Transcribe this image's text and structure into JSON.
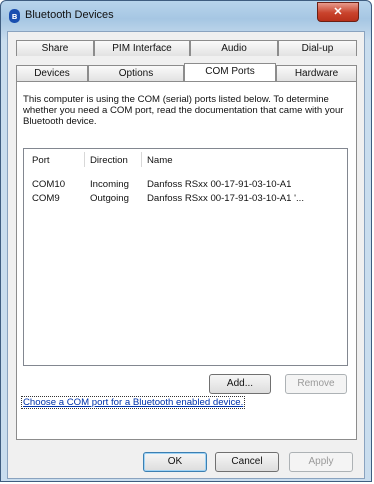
{
  "window": {
    "title": "Bluetooth Devices",
    "close_glyph": "✕"
  },
  "tabs_row_back": [
    {
      "label": "Share"
    },
    {
      "label": "PIM Interface"
    },
    {
      "label": "Audio"
    },
    {
      "label": "Dial-up"
    }
  ],
  "tabs_row_front": [
    {
      "label": "Devices"
    },
    {
      "label": "Options"
    },
    {
      "label": "COM Ports",
      "active": true
    },
    {
      "label": "Hardware"
    }
  ],
  "description": "This computer is using the COM (serial) ports listed below. To determine whether you need a COM port, read the documentation that came with your Bluetooth device.",
  "list": {
    "columns": [
      "Port",
      "Direction",
      "Name"
    ],
    "rows": [
      {
        "port": "COM10",
        "direction": "Incoming",
        "name": "Danfoss RSxx 00-17-91-03-10-A1"
      },
      {
        "port": "COM9",
        "direction": "Outgoing",
        "name": "Danfoss RSxx 00-17-91-03-10-A1 '..."
      }
    ]
  },
  "buttons": {
    "add": "Add...",
    "remove": "Remove",
    "ok": "OK",
    "cancel": "Cancel",
    "apply": "Apply"
  },
  "link_text": "Choose a COM port for a Bluetooth enabled device.",
  "colors": {
    "accent": "#0033aa",
    "title_bar": "#a6c6e3",
    "close": "#c9432c"
  },
  "icons": {
    "app": "bluetooth-icon",
    "close": "close-icon"
  }
}
